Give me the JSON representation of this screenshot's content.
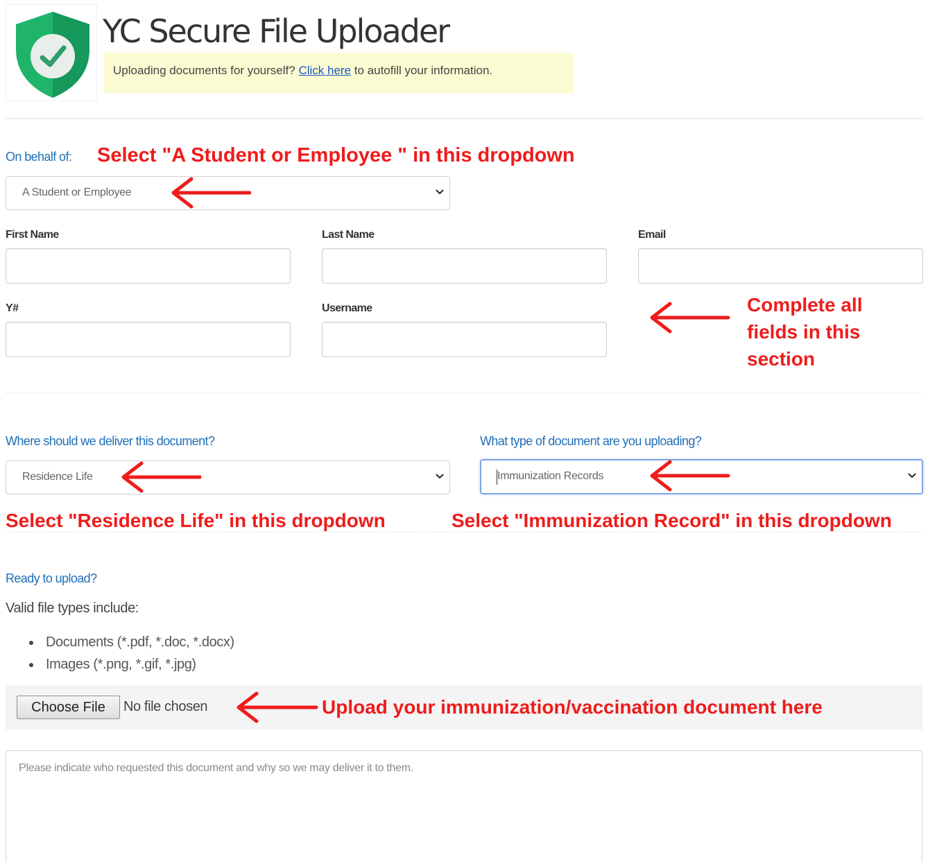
{
  "app": {
    "title": "YC Secure File Uploader",
    "logo_icon": "shield-check-icon",
    "brand_color": "#1fb46a"
  },
  "autofill_banner": {
    "prefix": "Uploading documents for yourself? ",
    "link": "Click here",
    "suffix": " to autofill your information."
  },
  "behalf": {
    "label": "On behalf of:",
    "selected": "A Student or Employee"
  },
  "fields": {
    "first_name": {
      "label": "First Name",
      "value": ""
    },
    "last_name": {
      "label": "Last Name",
      "value": ""
    },
    "email": {
      "label": "Email",
      "value": ""
    },
    "y_number": {
      "label": "Y#",
      "value": ""
    },
    "username": {
      "label": "Username",
      "value": ""
    }
  },
  "delivery": {
    "label": "Where should we deliver this document?",
    "selected": "Residence Life"
  },
  "doc_type": {
    "label": "What type of document are you uploading?",
    "selected": "Immunization Records"
  },
  "upload": {
    "heading": "Ready to upload?",
    "valid_types_label": "Valid file types include:",
    "file_types": [
      "Documents (*.pdf, *.doc, *.docx)",
      "Images (*.png, *.gif, *.jpg)"
    ],
    "choose_button": "Choose File",
    "no_file_text": "No file chosen"
  },
  "notes": {
    "placeholder": "Please indicate who requested this document and why so we may deliver it to them."
  },
  "annotations": {
    "behalf": "Select \"A Student or Employee \" in this dropdown",
    "fields": "Complete all fields in this section",
    "delivery": "Select \"Residence Life\" in this dropdown",
    "doc_type": "Select \"Immunization Record\" in this dropdown",
    "upload": "Upload your immunization/vaccination document here",
    "color": "#ee1c1c"
  }
}
